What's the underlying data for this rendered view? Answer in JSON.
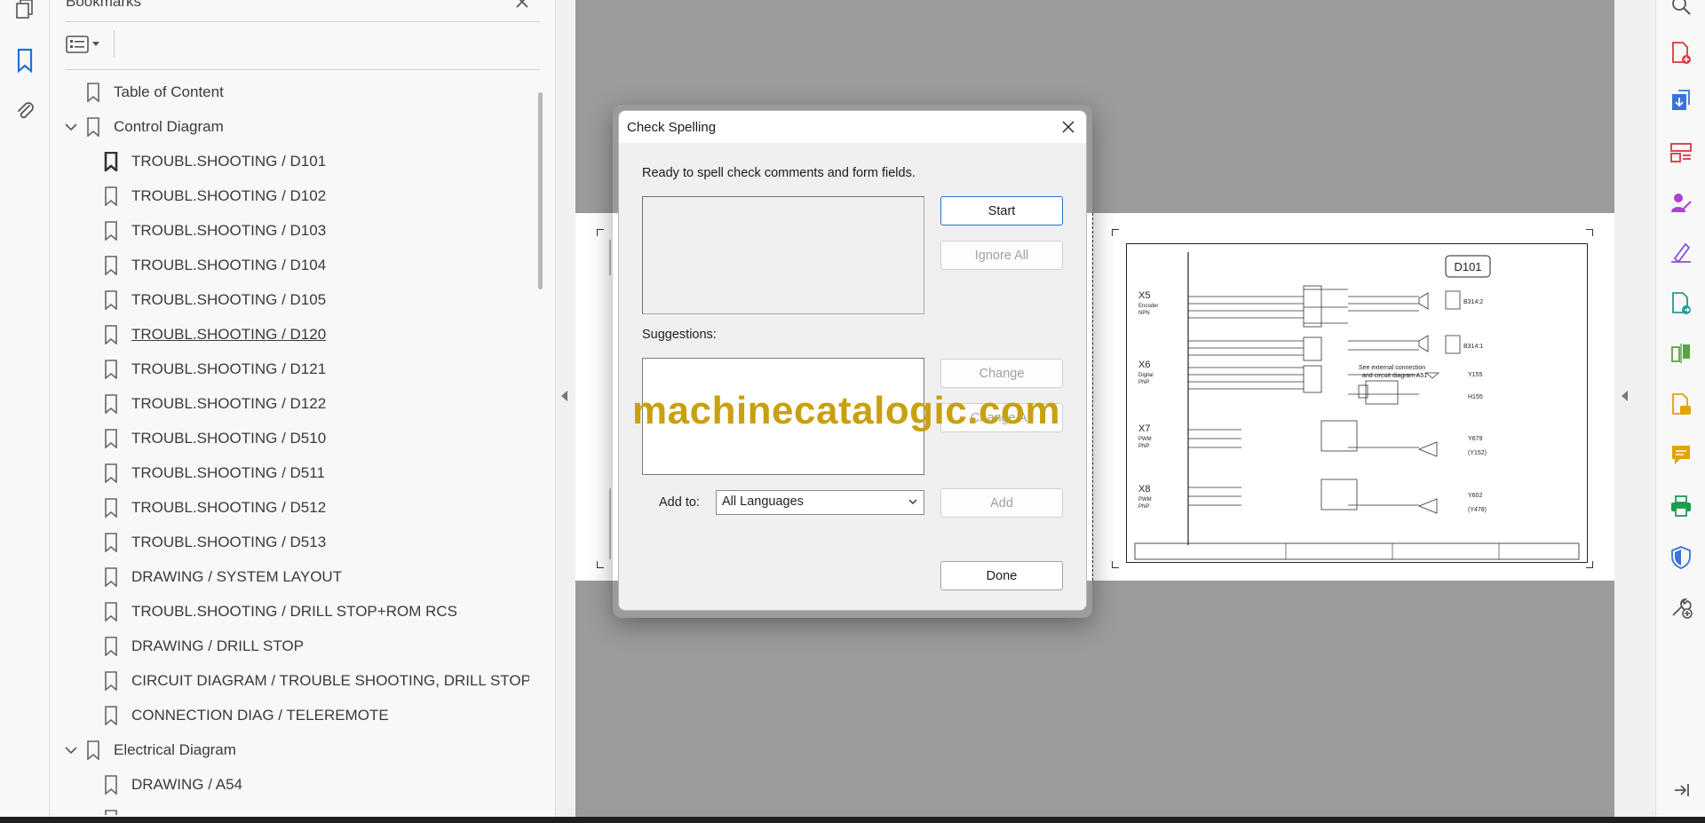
{
  "bookmarks_panel": {
    "title": "Bookmarks",
    "items": [
      {
        "label": "Table of Content",
        "level": 0,
        "expandable": false
      },
      {
        "label": "Control Diagram",
        "level": 0,
        "expandable": true
      },
      {
        "label": "TROUBL.SHOOTING / D101",
        "level": 1
      },
      {
        "label": "TROUBL.SHOOTING / D102",
        "level": 1
      },
      {
        "label": "TROUBL.SHOOTING / D103",
        "level": 1
      },
      {
        "label": "TROUBL.SHOOTING / D104",
        "level": 1
      },
      {
        "label": "TROUBL.SHOOTING / D105",
        "level": 1
      },
      {
        "label": "TROUBL.SHOOTING / D120",
        "level": 1,
        "hovered": true
      },
      {
        "label": "TROUBL.SHOOTING / D121",
        "level": 1
      },
      {
        "label": "TROUBL.SHOOTING / D122",
        "level": 1
      },
      {
        "label": "TROUBL.SHOOTING / D510",
        "level": 1
      },
      {
        "label": "TROUBL.SHOOTING / D511",
        "level": 1
      },
      {
        "label": "TROUBL.SHOOTING / D512",
        "level": 1
      },
      {
        "label": "TROUBL.SHOOTING / D513",
        "level": 1
      },
      {
        "label": "DRAWING / SYSTEM LAYOUT",
        "level": 1
      },
      {
        "label": "TROUBL.SHOOTING / DRILL STOP+ROM RCS",
        "level": 1
      },
      {
        "label": "DRAWING / DRILL STOP",
        "level": 1
      },
      {
        "label": "CIRCUIT DIAGRAM / TROUBLE SHOOTING, DRILL STOP",
        "level": 1
      },
      {
        "label": "CONNECTION DIAG / TELEREMOTE",
        "level": 1
      },
      {
        "label": "Electrical Diagram",
        "level": 0,
        "expandable": true
      },
      {
        "label": "DRAWING / A54",
        "level": 1
      }
    ]
  },
  "document": {
    "page_label": "D101",
    "sections": [
      {
        "id": "X5",
        "sub1": "Encoder",
        "sub2": "NPN"
      },
      {
        "id": "X6",
        "sub1": "Digital",
        "sub2": "PNP"
      },
      {
        "id": "X7",
        "sub1": "PWM",
        "sub2": "PNP"
      },
      {
        "id": "X8",
        "sub1": "PWM",
        "sub2": "PNP"
      }
    ],
    "components": [
      "B314:2",
      "B314:1",
      "Y155",
      "H155",
      "Y679",
      "(Y152)",
      "Y602",
      "(Y478)"
    ],
    "note_line1": "See external connection",
    "note_line2": "and circuit diagram A51"
  },
  "dialog": {
    "title": "Check Spelling",
    "message": "Ready to spell check comments and form fields.",
    "suggestions_label": "Suggestions:",
    "add_to_label": "Add to:",
    "language_value": "All Languages",
    "buttons": {
      "start": "Start",
      "ignore_all": "Ignore All",
      "change": "Change",
      "change_all": "Change All",
      "add": "Add",
      "done": "Done"
    }
  },
  "watermark": "machinecatalogic.com",
  "colors": {
    "accent": "#2b6cc4",
    "watermark": "#c8a010",
    "doc_background": "#9b9b9b"
  }
}
